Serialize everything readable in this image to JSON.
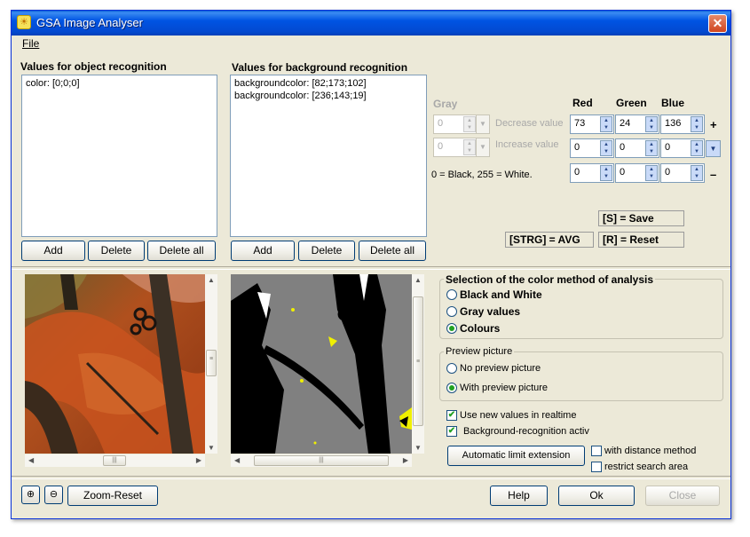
{
  "window": {
    "title": "GSA Image Analyser",
    "close_glyph": "✕"
  },
  "menu": {
    "file": "File"
  },
  "object_panel": {
    "label": "Values for object recognition",
    "items": [
      "color:  [0;0;0]"
    ],
    "add": "Add",
    "delete": "Delete",
    "delete_all": "Delete all"
  },
  "background_panel": {
    "label": "Values for background recognition",
    "items": [
      "backgroundcolor:  [82;173;102]",
      "backgroundcolor:  [236;143;19]"
    ],
    "add": "Add",
    "delete": "Delete",
    "delete_all": "Delete all"
  },
  "values": {
    "gray_label": "Gray",
    "red_label": "Red",
    "green_label": "Green",
    "blue_label": "Blue",
    "decrease_label": "Decrease value",
    "increase_label": "Increase value",
    "hint": "0 = Black, 255 = White.",
    "gray_decrease": "0",
    "gray_increase": "0",
    "row1": {
      "red": "73",
      "green": "24",
      "blue": "136",
      "sign": "+"
    },
    "row2": {
      "red": "0",
      "green": "0",
      "blue": "0"
    },
    "row3": {
      "red": "0",
      "green": "0",
      "blue": "0",
      "sign": "–"
    }
  },
  "shortcuts": {
    "save": "[S] = Save",
    "avg": "[STRG] = AVG",
    "reset": "[R] = Reset"
  },
  "color_method": {
    "title": "Selection of the color method of analysis",
    "options": [
      "Black and White",
      "Gray values",
      "Colours"
    ],
    "selected": 2
  },
  "preview": {
    "title": "Preview picture",
    "options": [
      "No preview picture",
      "With preview picture"
    ],
    "selected": 1
  },
  "checks": {
    "realtime": "Use new values in realtime",
    "background": "Background-recognition activ",
    "distance": "with distance method",
    "restrict": "restrict search area"
  },
  "buttons": {
    "auto_limit": "Automatic limit extension",
    "zoom_reset": "Zoom-Reset",
    "help": "Help",
    "ok": "Ok",
    "close": "Close"
  },
  "icons": {
    "app": "app-icon",
    "zoom_in": "zoom-in-icon",
    "zoom_out": "zoom-out-icon"
  }
}
